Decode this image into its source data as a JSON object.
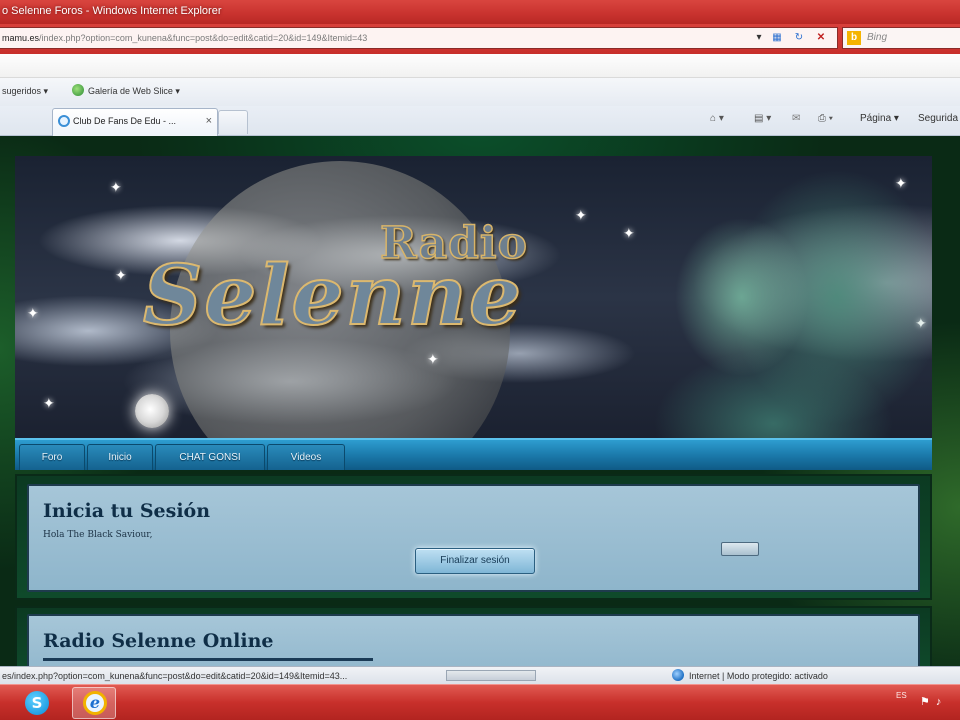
{
  "window": {
    "title": "o Selenne Foros - Windows Internet Explorer"
  },
  "address": {
    "domain": "mamu.es",
    "path": "/index.php?option=com_kunena&func=post&do=edit&catid=20&id=149&Itemid=43",
    "search_placeholder": "Bing"
  },
  "favorites": {
    "suggested_label": "sugeridos",
    "gallery_label": "Galería de Web Slice"
  },
  "tab": {
    "title": "Club De Fans De Edu - ...",
    "close_glyph": "×"
  },
  "commandbar": {
    "page_label": "Página",
    "safety_label": "Segurida"
  },
  "site": {
    "logo_top": "Radio",
    "logo_main": "Selenne",
    "nav": [
      "Foro",
      "Inicio",
      "CHAT GONSI",
      "Videos"
    ]
  },
  "login_panel": {
    "title": "Inicia tu Sesión",
    "greeting": "Hola The Black Saviour,",
    "logout_label": "Finalizar sesión"
  },
  "online_panel": {
    "title": "Radio Selenne Online"
  },
  "statusbar": {
    "url": "es/index.php?option=com_kunena&func=post&do=edit&catid=20&id=149&Itemid=43...",
    "zone": "Internet | Modo protegido: activado"
  },
  "taskbar": {
    "language": "ES"
  },
  "colors": {
    "ie_chrome_red": "#c8322e",
    "nav_blue": "#1b7aab",
    "panel_blue": "#9dbfd3",
    "panel_title": "#0f2e47"
  }
}
